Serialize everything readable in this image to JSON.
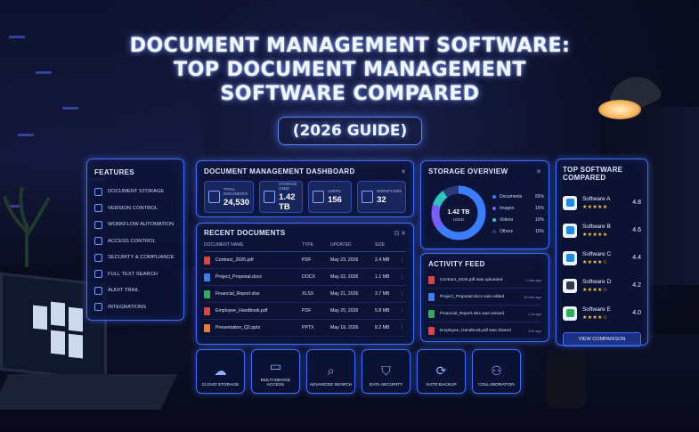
{
  "title": {
    "line1": "DOCUMENT MANAGEMENT SOFTWARE:",
    "line2": "TOP DOCUMENT MANAGEMENT",
    "line3": "SOFTWARE COMPARED",
    "subtitle": "(2026 GUIDE)"
  },
  "features": {
    "heading": "FEATURES",
    "items": [
      {
        "label": "DOCUMENT STORAGE",
        "icon": "file-icon"
      },
      {
        "label": "VERSION CONTROL",
        "icon": "history-icon"
      },
      {
        "label": "WORKFLOW AUTOMATION",
        "icon": "workflow-icon"
      },
      {
        "label": "ACCESS CONTROL",
        "icon": "lock-icon"
      },
      {
        "label": "SECURITY & COMPLIANCE",
        "icon": "shield-icon"
      },
      {
        "label": "FULL TEXT SEARCH",
        "icon": "search-icon"
      },
      {
        "label": "AUDIT TRAIL",
        "icon": "audit-icon"
      },
      {
        "label": "INTEGRATIONS",
        "icon": "plug-icon"
      }
    ]
  },
  "dashboard": {
    "heading": "DOCUMENT MANAGEMENT DASHBOARD",
    "stats": [
      {
        "label": "TOTAL DOCUMENTS",
        "value": "24,530",
        "icon": "document-icon"
      },
      {
        "label": "STORAGE USED",
        "value": "1.42 TB",
        "icon": "storage-icon"
      },
      {
        "label": "USERS",
        "value": "156",
        "icon": "user-icon"
      },
      {
        "label": "WORKFLOWS",
        "value": "32",
        "icon": "workflow-icon"
      }
    ]
  },
  "recent": {
    "heading": "RECENT DOCUMENTS",
    "columns": [
      "DOCUMENT NAME",
      "TYPE",
      "UPDATED",
      "SIZE"
    ],
    "rows": [
      {
        "name": "Contract_2026.pdf",
        "type": "PDF",
        "updated": "May 23, 2026",
        "size": "2.4 MB",
        "color": "#e0443a"
      },
      {
        "name": "Project_Proposal.docx",
        "type": "DOCX",
        "updated": "May 22, 2026",
        "size": "1.1 MB",
        "color": "#3b7dff"
      },
      {
        "name": "Financial_Report.xlsx",
        "type": "XLSX",
        "updated": "May 21, 2026",
        "size": "3.7 MB",
        "color": "#2fae5a"
      },
      {
        "name": "Employee_Handbook.pdf",
        "type": "PDF",
        "updated": "May 20, 2026",
        "size": "5.8 MB",
        "color": "#e0443a"
      },
      {
        "name": "Presentation_Q2.pptx",
        "type": "PPTX",
        "updated": "May 19, 2026",
        "size": "8.2 MB",
        "color": "#f07a2a"
      }
    ]
  },
  "storage": {
    "heading": "STORAGE OVERVIEW",
    "center_value": "1.42 TB",
    "center_label": "USED",
    "legend": [
      {
        "label": "Documents",
        "pct": "65%",
        "value": 65,
        "color": "#3b7dff"
      },
      {
        "label": "Images",
        "pct": "15%",
        "value": 15,
        "color": "#7b5cff"
      },
      {
        "label": "Videos",
        "pct": "10%",
        "value": 10,
        "color": "#2ec4c4"
      },
      {
        "label": "Others",
        "pct": "10%",
        "value": 10,
        "color": "#2a3a7a"
      }
    ]
  },
  "activity": {
    "heading": "ACTIVITY FEED",
    "rows": [
      {
        "text": "Contract_2026.pdf was uploaded",
        "ago": "2 min ago",
        "color": "#e0443a"
      },
      {
        "text": "Project_Proposal.docx was edited",
        "ago": "15 min ago",
        "color": "#3b7dff"
      },
      {
        "text": "Financial_Report.xlsx was viewed",
        "ago": "1 hr ago",
        "color": "#2fae5a"
      },
      {
        "text": "Employee_Handbook.pdf was shared",
        "ago": "3 hr ago",
        "color": "#e0443a"
      }
    ]
  },
  "top_software": {
    "heading": "TOP SOFTWARE COMPARED",
    "items": [
      {
        "name": "Software A",
        "rating": "4.8",
        "stars": "★★★★★",
        "logo_color": "#1e88e5"
      },
      {
        "name": "Software B",
        "rating": "4.6",
        "stars": "★★★★★",
        "logo_color": "#1e88e5"
      },
      {
        "name": "Software C",
        "rating": "4.4",
        "stars": "★★★★☆",
        "logo_color": "#1e88e5"
      },
      {
        "name": "Software D",
        "rating": "4.2",
        "stars": "★★★★☆",
        "logo_color": "#2f3a50"
      },
      {
        "name": "Software E",
        "rating": "4.0",
        "stars": "★★★★☆",
        "logo_color": "#2fae5a"
      }
    ],
    "button": "VIEW COMPARISON"
  },
  "bottom_features": [
    {
      "label": "CLOUD STORAGE",
      "icon": "cloud-icon"
    },
    {
      "label": "MULTI-DEVICE ACCESS",
      "icon": "devices-icon"
    },
    {
      "label": "ADVANCED SEARCH",
      "icon": "search-icon"
    },
    {
      "label": "DATA SECURITY",
      "icon": "shield-icon"
    },
    {
      "label": "AUTO BACKUP",
      "icon": "backup-icon"
    },
    {
      "label": "COLLABORATION",
      "icon": "team-icon"
    }
  ]
}
